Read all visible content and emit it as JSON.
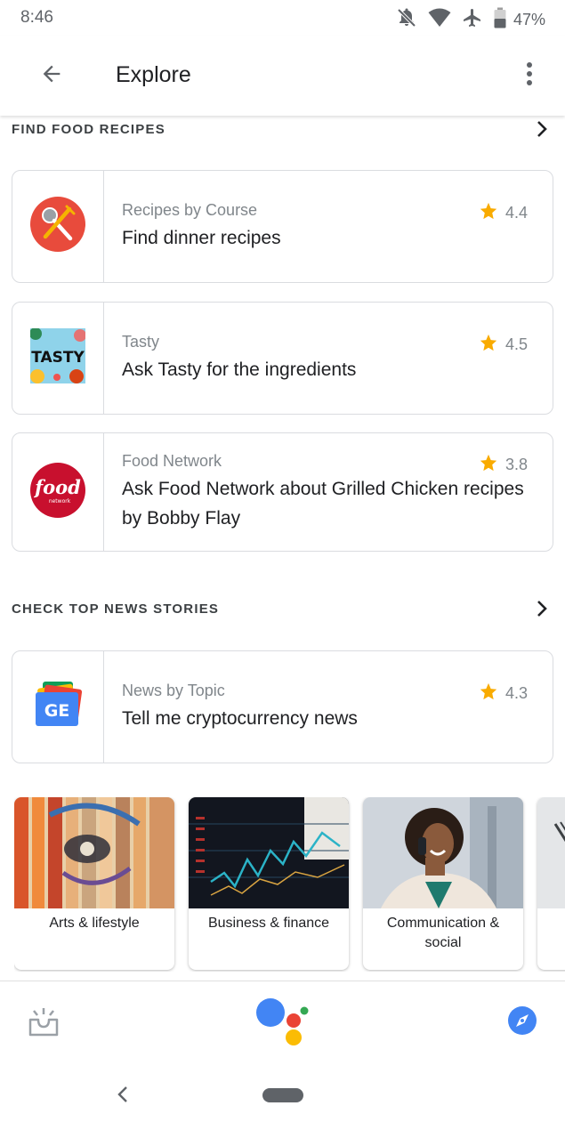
{
  "status_bar": {
    "time": "8:46",
    "battery": "47%",
    "icons": [
      "notifications-off-icon",
      "wifi-icon",
      "airplane-icon",
      "battery-icon"
    ]
  },
  "app_bar": {
    "title": "Explore",
    "back_icon": "arrow-back-icon",
    "menu_icon": "more-vert-icon"
  },
  "sections": {
    "food": {
      "title": "FIND FOOD RECIPES",
      "cards": [
        {
          "provider": "Recipes by Course",
          "query": "Find dinner recipes",
          "rating": "4.4",
          "icon": "recipes-by-course-logo"
        },
        {
          "provider": "Tasty",
          "query": "Ask Tasty for the ingredients",
          "rating": "4.5",
          "icon": "tasty-logo",
          "logo_text": "TASTY"
        },
        {
          "provider": "Food Network",
          "query": "Ask Food Network about Grilled Chicken recipes by Bobby Flay",
          "rating": "3.8",
          "icon": "food-network-logo",
          "logo_text": "food",
          "logo_subtext": "network"
        }
      ]
    },
    "news": {
      "title": "CHECK TOP NEWS STORIES",
      "cards": [
        {
          "provider": "News by Topic",
          "query": "Tell me cryptocurrency news",
          "rating": "4.3",
          "icon": "google-news-logo",
          "logo_text": "GE"
        }
      ]
    }
  },
  "topics": [
    {
      "label": "Arts & lifestyle"
    },
    {
      "label": "Business & finance"
    },
    {
      "label": "Communication & social"
    }
  ],
  "bottom_bar": {
    "left_icon": "updates-tray-icon",
    "center_icon": "google-assistant-logo",
    "right_icon": "explore-compass-icon"
  },
  "colors": {
    "star": "#f9ab00",
    "assistant_blue": "#4285f4",
    "assistant_red": "#ea4335",
    "assistant_yellow": "#fbbc04",
    "assistant_green": "#34a853",
    "recipes_red": "#e84b3c",
    "food_network_red": "#c8102e"
  }
}
